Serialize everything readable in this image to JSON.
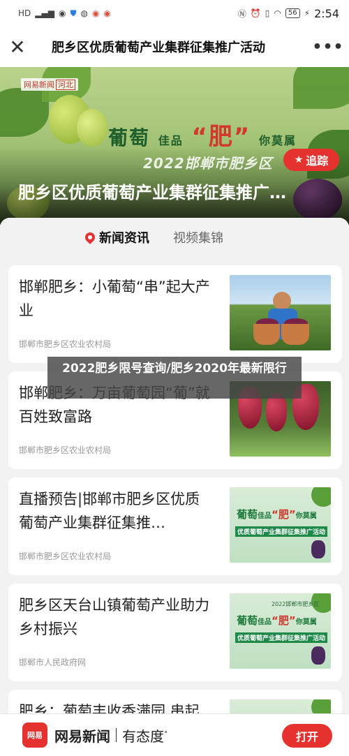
{
  "status_bar": {
    "left_text": "HD",
    "signal": "4G",
    "battery": "56",
    "time": "2:54"
  },
  "nav": {
    "title": "肥乡区优质葡萄产业集群征集推广活动",
    "close_icon": "close-icon",
    "more_icon": "more-icon"
  },
  "banner": {
    "logo_text": "网易新闻",
    "logo_badge": "河北",
    "slogan_part1": "葡萄",
    "slogan_part2": "佳品",
    "slogan_part3": "“肥”",
    "slogan_part4": "你莫属",
    "year_text": "2022邯郸市肥乡区",
    "title": "肥乡区优质葡萄产业集群征集推广…",
    "follow_label": "追踪"
  },
  "tabs": [
    {
      "label": "新闻资讯",
      "active": true
    },
    {
      "label": "视频集锦",
      "active": false
    }
  ],
  "articles": [
    {
      "title": "邯郸肥乡：小葡萄“串”起大产业",
      "source": "邯郸市肥乡区农业农村局"
    },
    {
      "title": "邯郸肥乡：万亩葡萄园“葡”就百姓致富路",
      "source": "邯郸市肥乡区农业农村局"
    },
    {
      "title": "直播预告|邯郸市肥乡区优质葡萄产业集群征集推…",
      "source": "邯郸市肥乡区农业农村局",
      "thumb_line1a": "葡萄",
      "thumb_line1b": "佳品",
      "thumb_line1c": "“肥”",
      "thumb_line1d": "你莫属",
      "thumb_line2": "优质葡萄产业集群征集推广活动"
    },
    {
      "title": "肥乡区天台山镇葡萄产业助力乡村振兴",
      "source": "邯郸市人民政府网",
      "thumb_line1a": "葡萄",
      "thumb_line1b": "佳品",
      "thumb_line1c": "“肥”",
      "thumb_line1d": "你莫属",
      "thumb_line2": "优质葡萄产业集群征集推广活动",
      "thumb_year": "2022邯郸市肥乡区"
    },
    {
      "title": "肥乡：葡萄丰收香满园 串起"
    }
  ],
  "overlay": {
    "text": "2022肥乡限号查询/肥乡2020年最新限行"
  },
  "bottom_bar": {
    "logo_text": "网易",
    "brand": "网易新闻",
    "slogan": "有态度",
    "open_label": "打开"
  }
}
